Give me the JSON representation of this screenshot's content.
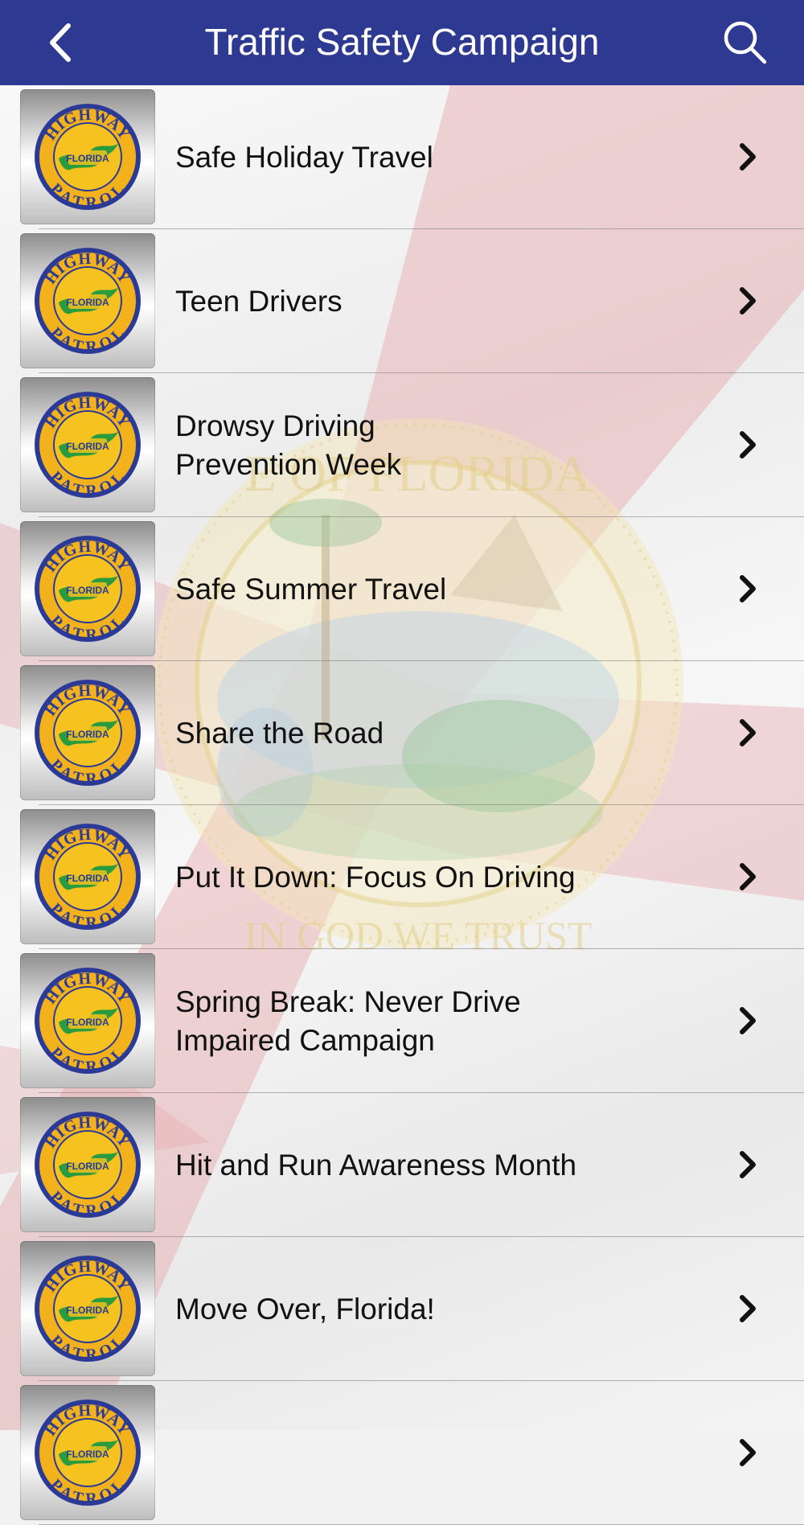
{
  "header": {
    "title": "Traffic Safety Campaign",
    "back_icon": "chevron-left-icon",
    "search_icon": "search-icon",
    "background_color": "#2e3a92"
  },
  "badge": {
    "top_text": "HIGHWAY",
    "middle_text": "FLORIDA",
    "bottom_text": "PATROL"
  },
  "campaigns": [
    {
      "line1": "Safe Holiday Travel",
      "line2": ""
    },
    {
      "line1": "Teen Drivers",
      "line2": ""
    },
    {
      "line1": "Drowsy Driving",
      "line2": "Prevention Week"
    },
    {
      "line1": "Safe Summer Travel",
      "line2": ""
    },
    {
      "line1": "Share the Road",
      "line2": ""
    },
    {
      "line1": "Put It Down: Focus On Driving",
      "line2": ""
    },
    {
      "line1": "Spring Break: Never Drive",
      "line2": "Impaired Campaign"
    },
    {
      "line1": "Hit and Run Awareness Month",
      "line2": ""
    },
    {
      "line1": "Move Over, Florida!",
      "line2": ""
    },
    {
      "line1": "",
      "line2": ""
    }
  ],
  "background": {
    "seal_top_text": "E OF FLORIDA",
    "seal_bottom_text": "IN GOD WE TRUST"
  }
}
